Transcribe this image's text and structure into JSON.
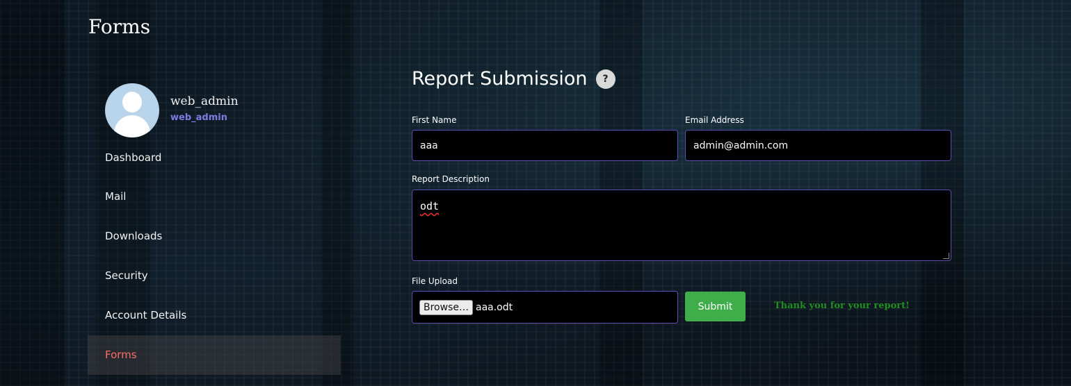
{
  "page": {
    "title": "Forms"
  },
  "profile": {
    "name": "web_admin",
    "handle": "web_admin"
  },
  "sidebar": {
    "items": [
      {
        "label": "Dashboard",
        "active": false
      },
      {
        "label": "Mail",
        "active": false
      },
      {
        "label": "Downloads",
        "active": false
      },
      {
        "label": "Security",
        "active": false
      },
      {
        "label": "Account Details",
        "active": false
      },
      {
        "label": "Forms",
        "active": true
      }
    ]
  },
  "form": {
    "heading": "Report Submission",
    "help_label": "?",
    "first_name": {
      "label": "First Name",
      "value": "aaa"
    },
    "email": {
      "label": "Email Address",
      "value": "admin@admin.com"
    },
    "description": {
      "label": "Report Description",
      "value": "odt"
    },
    "file": {
      "label": "File Upload",
      "browse_label": "Browse…",
      "filename": "aaa.odt"
    },
    "submit_label": "Submit",
    "confirmation": "Thank you for your report!"
  },
  "colors": {
    "accent": "#5b4fb0",
    "active_nav": "#ff6b6b",
    "submit": "#3fae4a",
    "success_text": "#1f8f1f",
    "handle": "#7e7ae0"
  }
}
